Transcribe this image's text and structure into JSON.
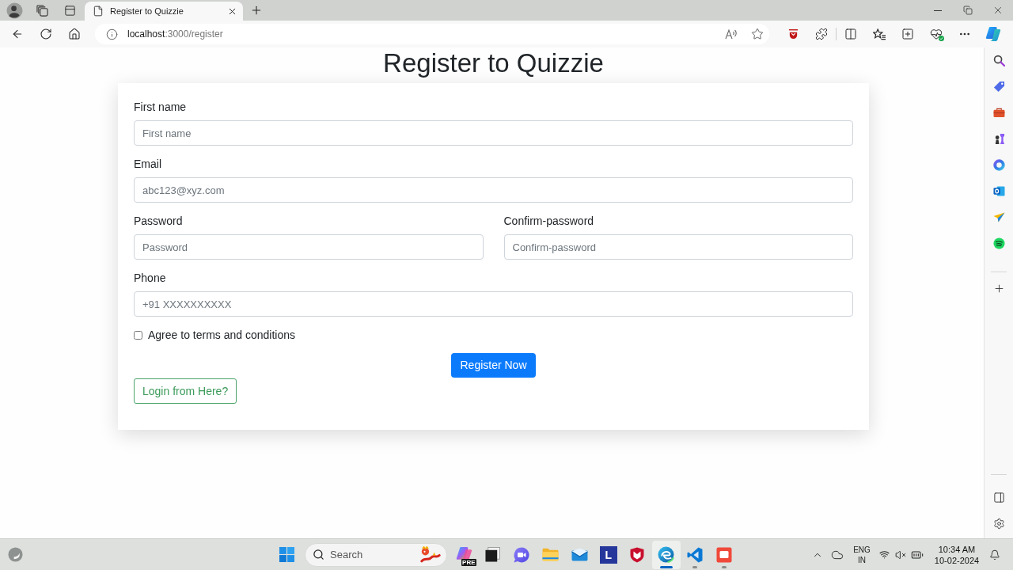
{
  "browser": {
    "tabs": [
      {
        "title": "Register to Quizzie",
        "selected": true
      }
    ],
    "address": {
      "host": "localhost",
      "path": ":3000/register"
    }
  },
  "page": {
    "heading": "Register to Quizzie",
    "rows": [
      {
        "fields": [
          {
            "label": "First name",
            "placeholder": "First name"
          }
        ]
      },
      {
        "fields": [
          {
            "label": "Email",
            "placeholder": "abc123@xyz.com"
          }
        ]
      },
      {
        "fields": [
          {
            "label": "Password",
            "placeholder": "Password"
          },
          {
            "label": "Confirm-password",
            "placeholder": "Confirm-password"
          }
        ]
      },
      {
        "fields": [
          {
            "label": "Phone",
            "placeholder": "+91 XXXXXXXXXX"
          }
        ]
      }
    ],
    "checkbox": {
      "label": "Agree to terms and conditions",
      "checked": false
    },
    "buttons": [
      {
        "label": "Register Now",
        "kind": "primary"
      },
      {
        "label": "Login from Here?",
        "kind": "outline"
      }
    ]
  },
  "taskbar": {
    "search": {
      "label": "Search"
    },
    "apps": [
      {
        "kind": "copilot",
        "badge": "PRE",
        "open": false,
        "selected": false
      },
      {
        "kind": "dark-square",
        "open": false,
        "selected": false
      },
      {
        "kind": "video-chat",
        "open": false,
        "selected": false
      },
      {
        "kind": "folder",
        "open": false,
        "selected": false
      },
      {
        "kind": "mail",
        "open": false,
        "selected": false
      },
      {
        "kind": "letter",
        "label": "L",
        "open": false,
        "selected": false
      },
      {
        "kind": "shield",
        "open": false,
        "selected": false
      },
      {
        "kind": "browser",
        "open": true,
        "selected": true
      },
      {
        "kind": "code",
        "open": true,
        "selected": false
      },
      {
        "kind": "recorder",
        "open": true,
        "selected": false
      }
    ],
    "language": [
      "ENG",
      "IN"
    ],
    "time": "10:34 AM",
    "date": "10-02-2024"
  }
}
